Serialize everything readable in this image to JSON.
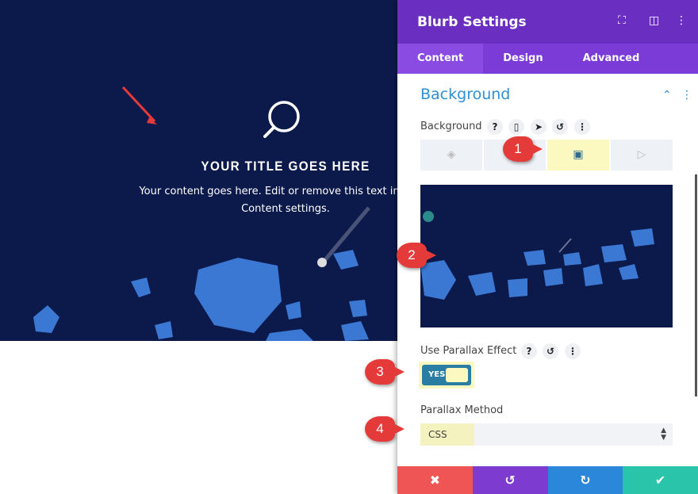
{
  "preview": {
    "title": "YOUR TITLE GOES HERE",
    "content_line1": "Your content goes here. Edit or remove this text inline or",
    "content_line2": "Content settings."
  },
  "panel": {
    "title": "Blurb Settings",
    "tabs": [
      {
        "label": "Content",
        "active": true
      },
      {
        "label": "Design"
      },
      {
        "label": "Advanced"
      }
    ],
    "section": "Background",
    "background_label": "Background",
    "bg_types": [
      "color",
      "gradient",
      "image",
      "video"
    ],
    "bg_selected": "image",
    "parallax_label": "Use Parallax Effect",
    "parallax_value": "YES",
    "method_label": "Parallax Method",
    "method_value": "CSS",
    "footer": [
      "close",
      "undo",
      "redo",
      "save"
    ]
  },
  "callouts": [
    "1",
    "2",
    "3",
    "4"
  ],
  "colors": {
    "header": "#6a2fc0",
    "tabs": "#7b3bd6",
    "accent": "#2e8ed6",
    "highlight": "#fbf8c0",
    "cancel": "#ef5555",
    "undo": "#7e3bd0",
    "redo": "#2b87da",
    "save": "#29c4a9"
  }
}
